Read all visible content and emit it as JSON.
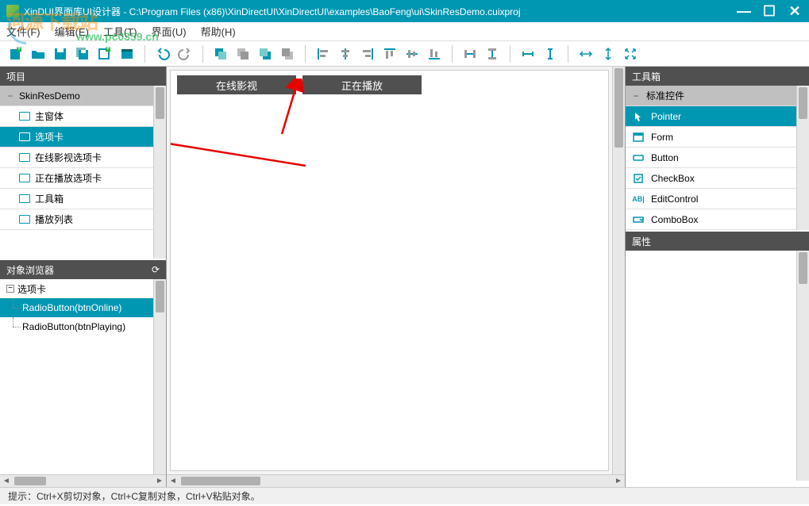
{
  "window": {
    "title": "XinDUI界面库UI设计器 - C:\\Program Files (x86)\\XinDirectUI\\XinDirectUI\\examples\\BaoFeng\\ui\\SkinResDemo.cuixproj"
  },
  "watermark": {
    "main": "河源下载站",
    "sub": "www.pc0359.cn"
  },
  "menu": {
    "file": "文件(F)",
    "edit": "编辑(E)",
    "tool": "工具(T)",
    "ui": "界面(U)",
    "help": "帮助(H)"
  },
  "panels": {
    "project": "项目",
    "object_browser": "对象浏览器",
    "toolbox": "工具箱",
    "properties": "属性"
  },
  "project_tree": {
    "root": "SkinResDemo",
    "items": [
      "主窗体",
      "选项卡",
      "在线影视选项卡",
      "正在播放选项卡",
      "工具箱",
      "播放列表"
    ],
    "selected_index": 1
  },
  "object_tree": {
    "root": "选项卡",
    "children": [
      "RadioButton(btnOnline)",
      "RadioButton(btnPlaying)"
    ],
    "selected_index": 0
  },
  "canvas": {
    "tabs": [
      "在线影视",
      "正在播放"
    ]
  },
  "toolbox": {
    "header": "标准控件",
    "items": [
      "Pointer",
      "Form",
      "Button",
      "CheckBox",
      "EditControl",
      "ComboBox"
    ],
    "selected_index": 0
  },
  "status": "提示：Ctrl+X剪切对象，Ctrl+C复制对象，Ctrl+V粘贴对象。"
}
